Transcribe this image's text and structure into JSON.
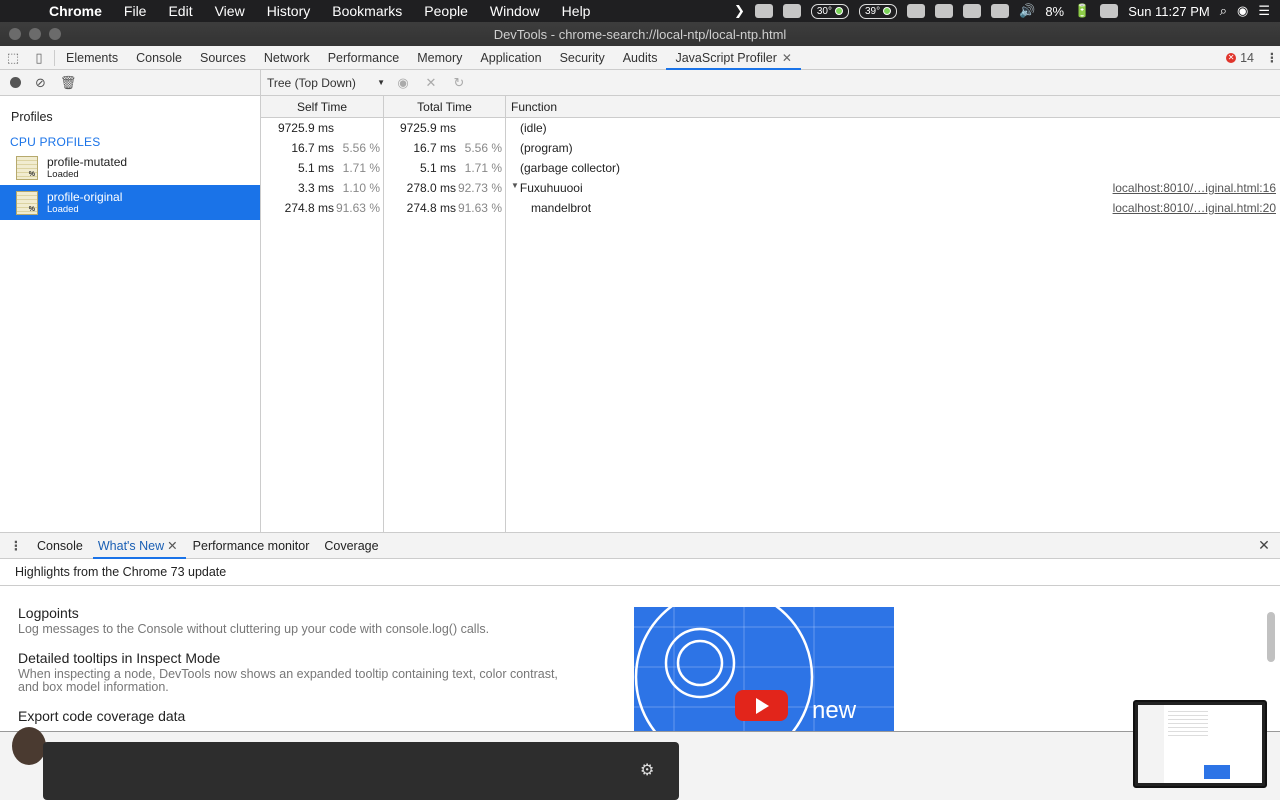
{
  "menubar": {
    "app": "Chrome",
    "items": [
      "File",
      "Edit",
      "View",
      "History",
      "Bookmarks",
      "People",
      "Window",
      "Help"
    ],
    "temp1": "30°",
    "temp2": "39°",
    "battery": "8%",
    "clock": "Sun 11:27 PM"
  },
  "window": {
    "title": "DevTools - chrome-search://local-ntp/local-ntp.html"
  },
  "devtools": {
    "tabs": [
      "Elements",
      "Console",
      "Sources",
      "Network",
      "Performance",
      "Memory",
      "Application",
      "Security",
      "Audits",
      "JavaScript Profiler"
    ],
    "active_tab": "JavaScript Profiler",
    "error_count": "14"
  },
  "sidebar": {
    "profiles_label": "Profiles",
    "section_title": "CPU PROFILES",
    "profiles": [
      {
        "name": "profile-mutated",
        "status": "Loaded",
        "selected": false
      },
      {
        "name": "profile-original",
        "status": "Loaded",
        "selected": true
      }
    ]
  },
  "profiler": {
    "view_mode": "Tree (Top Down)",
    "columns": {
      "self": "Self Time",
      "total": "Total Time",
      "function": "Function"
    },
    "rows": [
      {
        "self": "9725.9 ms",
        "self_pct": "",
        "total": "9725.9 ms",
        "total_pct": "",
        "function": "(idle)",
        "link": "",
        "expanded": false
      },
      {
        "self": "16.7 ms",
        "self_pct": "5.56 %",
        "total": "16.7 ms",
        "total_pct": "5.56 %",
        "function": "(program)",
        "link": "",
        "expanded": false
      },
      {
        "self": "5.1 ms",
        "self_pct": "1.71 %",
        "total": "5.1 ms",
        "total_pct": "1.71 %",
        "function": "(garbage collector)",
        "link": "",
        "expanded": false
      },
      {
        "self": "3.3 ms",
        "self_pct": "1.10 %",
        "total": "278.0 ms",
        "total_pct": "92.73 %",
        "function": "Fuxuhuuooi",
        "link": "localhost:8010/…iginal.html:16",
        "expanded": true
      },
      {
        "self": "274.8 ms",
        "self_pct": "91.63 %",
        "total": "274.8 ms",
        "total_pct": "91.63 %",
        "function": "mandelbrot",
        "link": "localhost:8010/…iginal.html:20",
        "expanded": false
      }
    ]
  },
  "drawer": {
    "tabs": [
      "Console",
      "What's New",
      "Performance monitor",
      "Coverage"
    ],
    "active_tab": "What's New",
    "highlights": "Highlights from the Chrome 73 update",
    "items": [
      {
        "title": "Logpoints",
        "desc": "Log messages to the Console without cluttering up your code with console.log() calls."
      },
      {
        "title": "Detailed tooltips in Inspect Mode",
        "desc": "When inspecting a node, DevTools now shows an expanded tooltip containing text, color contrast, and box model information."
      },
      {
        "title": "Export code coverage data",
        "desc": ""
      }
    ],
    "video_text": "new"
  },
  "colors": {
    "accent": "#1a73e8",
    "error": "#e0342b",
    "video_bg": "#2d74e6",
    "youtube": "#e2251b"
  }
}
